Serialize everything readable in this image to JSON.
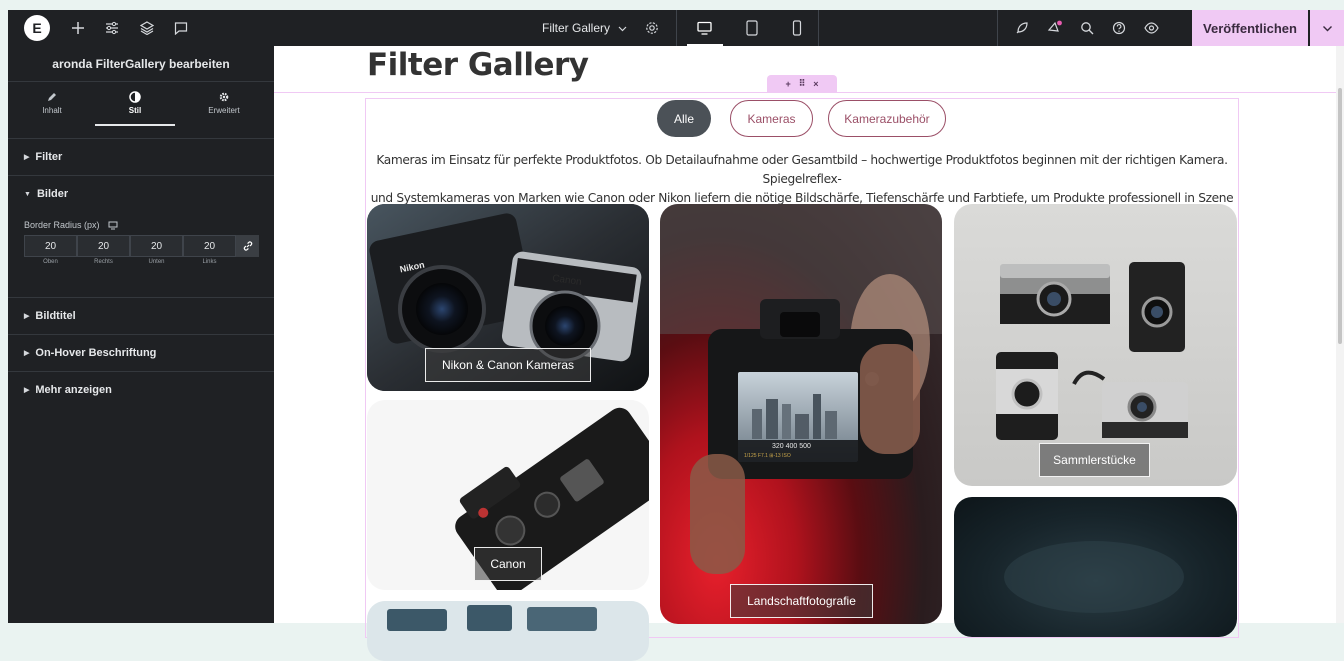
{
  "topbar": {
    "logo_letter": "E",
    "document_title": "Filter Gallery",
    "publish_label": "Veröffentlichen",
    "icons": [
      "add-icon",
      "settings-sliders-icon",
      "layers-icon",
      "comments-icon",
      "chevron-down-icon",
      "gear-icon",
      "desktop-icon",
      "tablet-icon",
      "mobile-icon",
      "rocket-icon",
      "notifications-icon",
      "search-icon",
      "help-icon",
      "preview-eye-icon",
      "chevron-down-icon"
    ]
  },
  "panel": {
    "title": "aronda FilterGallery bearbeiten",
    "tabs": [
      {
        "label": "Inhalt",
        "icon": "pencil-icon"
      },
      {
        "label": "Stil",
        "icon": "half-circle-icon"
      },
      {
        "label": "Erweitert",
        "icon": "gear-icon"
      }
    ],
    "sections": {
      "filter": "Filter",
      "bilder": "Bilder",
      "bildtitel": "Bildtitel",
      "hover": "On-Hover Beschriftung",
      "mehr": "Mehr anzeigen"
    },
    "border_radius": {
      "label": "Border Radius (px)",
      "values": [
        "20",
        "20",
        "20",
        "20"
      ],
      "captions": [
        "Oben",
        "Rechts",
        "Unten",
        "Links"
      ]
    }
  },
  "canvas": {
    "page_title": "Filter Gallery",
    "filters": [
      "Alle",
      "Kameras",
      "Kamerazubehör"
    ],
    "active_filter": "Alle",
    "description_line1": "Kameras im Einsatz für perfekte Produktfotos. Ob Detailaufnahme oder Gesamtbild – hochwertige Produktfotos beginnen mit der richtigen Kamera. Spiegelreflex-",
    "description_line2": "und Systemkameras von Marken wie Canon oder Nikon liefern die nötige Bildschärfe, Tiefenschärfe und Farbtiefe, um Produkte professionell in Szene zu setzen.",
    "gallery": [
      {
        "caption": "Nikon & Canon Kameras"
      },
      {
        "caption": "Landschaftfotografie"
      },
      {
        "caption": "Sammlerstücke"
      },
      {
        "caption": "Canon"
      }
    ],
    "photo_text": {
      "nikon": "Nikon",
      "canon": "Canon",
      "display_values": "320  400  500",
      "display_sub": "1/125   F7.1   ⊞-13  ISO"
    }
  },
  "colors": {
    "topbar_bg": "#1f2124",
    "publish_bg": "#f0c9f4",
    "filter_active_bg": "#4b5157",
    "filter_accent": "#9b4f67"
  }
}
